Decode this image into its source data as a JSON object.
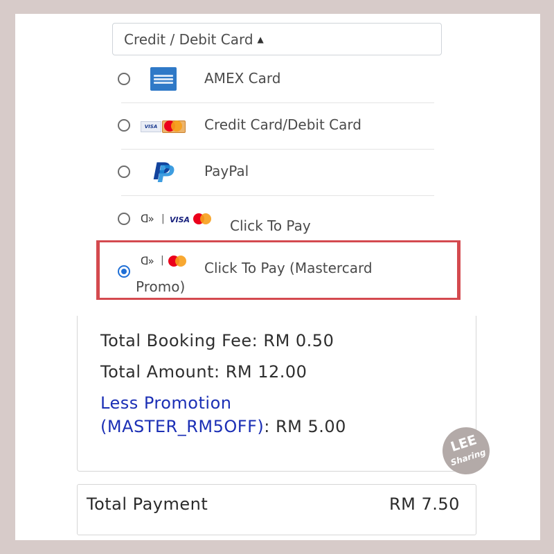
{
  "dropdown": {
    "label": "Credit / Debit Card",
    "caret_icon": "caret-up-icon"
  },
  "methods": [
    {
      "label": "AMEX Card",
      "selected": false,
      "icon": "amex-logo-icon"
    },
    {
      "label": "Credit Card/Debit Card",
      "selected": false,
      "icon": "visa-mastercard-icon"
    },
    {
      "label": "PayPal",
      "selected": false,
      "icon": "paypal-logo-icon",
      "icon_text": "P"
    },
    {
      "label": "Click To Pay",
      "selected": false,
      "icon": "click-to-pay-icon",
      "glyph": "ᗡ»",
      "visa_text": "VISA"
    },
    {
      "label": "Click To Pay (Mastercard",
      "label_cont": "Promo)",
      "selected": true,
      "icon": "click-to-pay-mastercard-icon",
      "glyph": "ᗡ»"
    }
  ],
  "summary": {
    "booking_fee": "Total Booking Fee: RM 0.50",
    "total_amount": "Total Amount: RM 12.00",
    "promo_line1": "Less Promotion",
    "promo_code": "(MASTER_RM5OFF)",
    "promo_value": ": RM 5.00"
  },
  "total": {
    "label": "Total Payment",
    "value": "RM 7.50"
  },
  "watermark": {
    "line1": "LEE",
    "line2": "Sharing"
  },
  "colors": {
    "background": "#d7cbc9",
    "highlight_border": "#d44a4f",
    "radio_selected": "#1f6fd6",
    "promo_text": "#1b2fb5",
    "paypal_dark": "#12439d",
    "paypal_light": "#1d8ddb",
    "amex_blue": "#2f79c7"
  }
}
